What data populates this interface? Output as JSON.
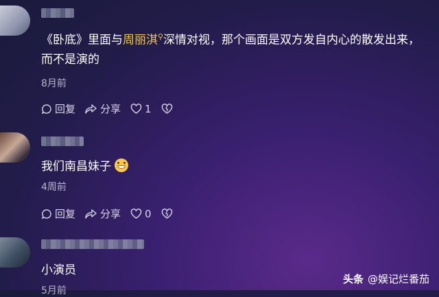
{
  "comments": [
    {
      "text_pre": "《卧底》里面与",
      "text_highlight": "周丽淇",
      "text_post": "深情对视，那个画面是双方发自内心的散发出来，而不是演的",
      "time": "8月前",
      "reply_label": "回复",
      "share_label": "分享",
      "like_count": "1"
    },
    {
      "text": "我们南昌妹子",
      "time": "4周前",
      "reply_label": "回复",
      "share_label": "分享",
      "like_count": "0"
    },
    {
      "text": "小演员",
      "time": "5月前"
    }
  ],
  "watermark": {
    "brand": "头条",
    "handle": "@娱记烂番茄"
  }
}
